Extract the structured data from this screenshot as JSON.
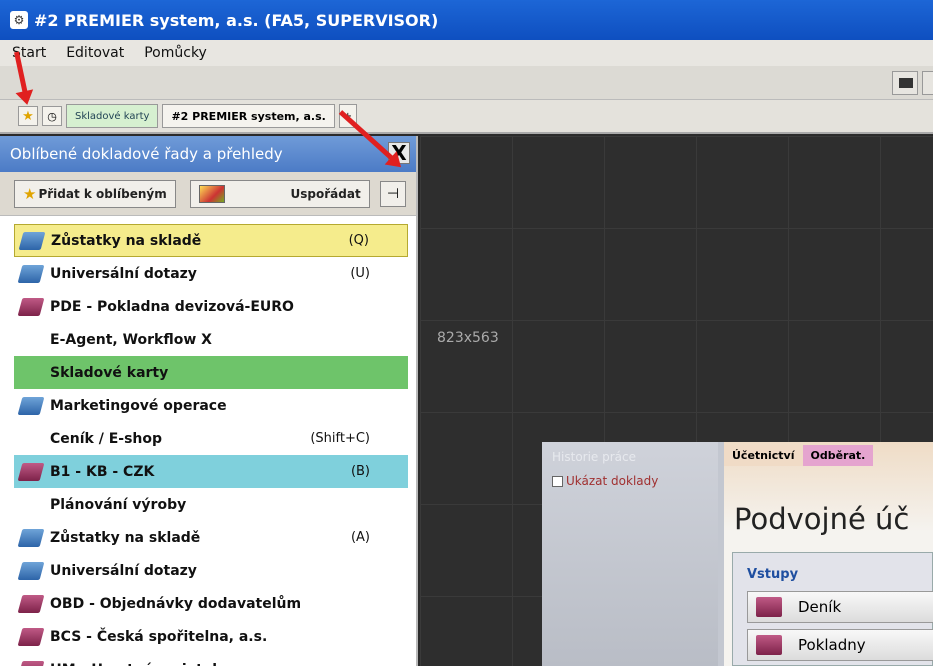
{
  "window": {
    "title": "#2 PREMIER system, a.s. (FA5, SUPERVISOR)"
  },
  "menu": {
    "items": [
      "Start",
      "Editovat",
      "Pomůcky"
    ]
  },
  "tabbar": {
    "tabs": [
      {
        "label": "Skladové karty"
      },
      {
        "label": "#2 PREMIER system, a.s."
      }
    ],
    "plus_label": "+"
  },
  "panel": {
    "title": "Oblíbené dokladové řady a přehledy",
    "close_label": "X",
    "add_label": "Přidat k oblíbeným",
    "arrange_label": "Uspořádat",
    "pin_icon": "pin-icon",
    "items": [
      {
        "label": "Zůstatky na skladě",
        "shortcut": "(Q)",
        "icon": "book-blue",
        "highlight": "#f5ec8c"
      },
      {
        "label": "Universální dotazy",
        "shortcut": "(U)",
        "icon": "book-blue",
        "highlight": ""
      },
      {
        "label": "PDE - Pokladna devizová-EURO",
        "shortcut": "",
        "icon": "book-maroon",
        "highlight": ""
      },
      {
        "label": "E-Agent, Workflow X",
        "shortcut": "",
        "icon": "none",
        "highlight": ""
      },
      {
        "label": "Skladové karty",
        "shortcut": "",
        "icon": "none",
        "highlight": "#6ec46a"
      },
      {
        "label": "Marketingové operace",
        "shortcut": "",
        "icon": "book-blue",
        "highlight": ""
      },
      {
        "label": "Ceník / E-shop",
        "shortcut": "(Shift+C)",
        "icon": "none",
        "highlight": ""
      },
      {
        "label": "B1 - KB - CZK",
        "shortcut": "(B)",
        "icon": "book-maroon",
        "highlight": "#7fd0dc"
      },
      {
        "label": "Plánování výroby",
        "shortcut": "",
        "icon": "none",
        "highlight": ""
      },
      {
        "label": "Zůstatky na skladě",
        "shortcut": "(A)",
        "icon": "book-blue",
        "highlight": ""
      },
      {
        "label": "Universální dotazy",
        "shortcut": "",
        "icon": "book-blue",
        "highlight": ""
      },
      {
        "label": "OBD - Objednávky dodavatelům",
        "shortcut": "",
        "icon": "book-maroon",
        "highlight": ""
      },
      {
        "label": "BCS - Česká spořitelna, a.s.",
        "shortcut": "",
        "icon": "book-maroon",
        "highlight": ""
      },
      {
        "label": "HM - Hmotný majetek",
        "shortcut": "",
        "icon": "book-maroon",
        "highlight": ""
      }
    ]
  },
  "workspace": {
    "size_label": "823x563"
  },
  "inner": {
    "history_title": "Historie práce",
    "show_docs_label": "Ukázat doklady",
    "tabs": [
      {
        "label": "Účetnictví"
      },
      {
        "label": "Odběrat."
      }
    ],
    "heading": "Podvojné úč",
    "group_label": "Vstupy",
    "rows": [
      {
        "label": "Deník"
      },
      {
        "label": "Pokladny"
      }
    ]
  }
}
